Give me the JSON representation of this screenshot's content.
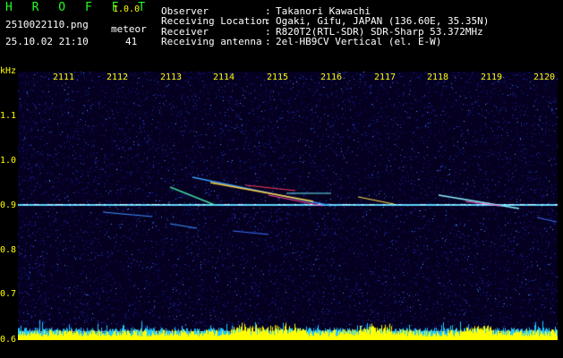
{
  "app": {
    "logo": "H R O F F T",
    "version": "1.0.0"
  },
  "file": {
    "name": "2510022110.png",
    "datetime": "25.10.02 21:10"
  },
  "meteor": {
    "label": "meteor",
    "count": "41"
  },
  "info": [
    {
      "label": "Observer",
      "sep": ":",
      "value": "Takanori Kawachi"
    },
    {
      "label": "Receiving Location",
      "sep": ":",
      "value": "Ogaki, Gifu, JAPAN (136.60E, 35.35N)"
    },
    {
      "label": "Receiver",
      "sep": ":",
      "value": "R820T2(RTL-SDR) SDR-Sharp 53.372MHz"
    },
    {
      "label": "Receiving antenna",
      "sep": ":",
      "value": "2el-HB9CV Vertical (el. E-W)"
    }
  ],
  "axis": {
    "y_unit": "kHz",
    "y_ticks": [
      "1.1",
      "1.0",
      "0.9",
      "0.8",
      "0.7",
      "0.6"
    ],
    "x_ticks": [
      "2111",
      "2112",
      "2113",
      "2114",
      "2115",
      "2116",
      "2117",
      "2118",
      "2119",
      "2120"
    ]
  },
  "colors": {
    "background": "#000000",
    "label": "#ffff00",
    "logo": "#22ff22",
    "text": "#ffffff",
    "carrier": "#5ad6ff"
  }
}
